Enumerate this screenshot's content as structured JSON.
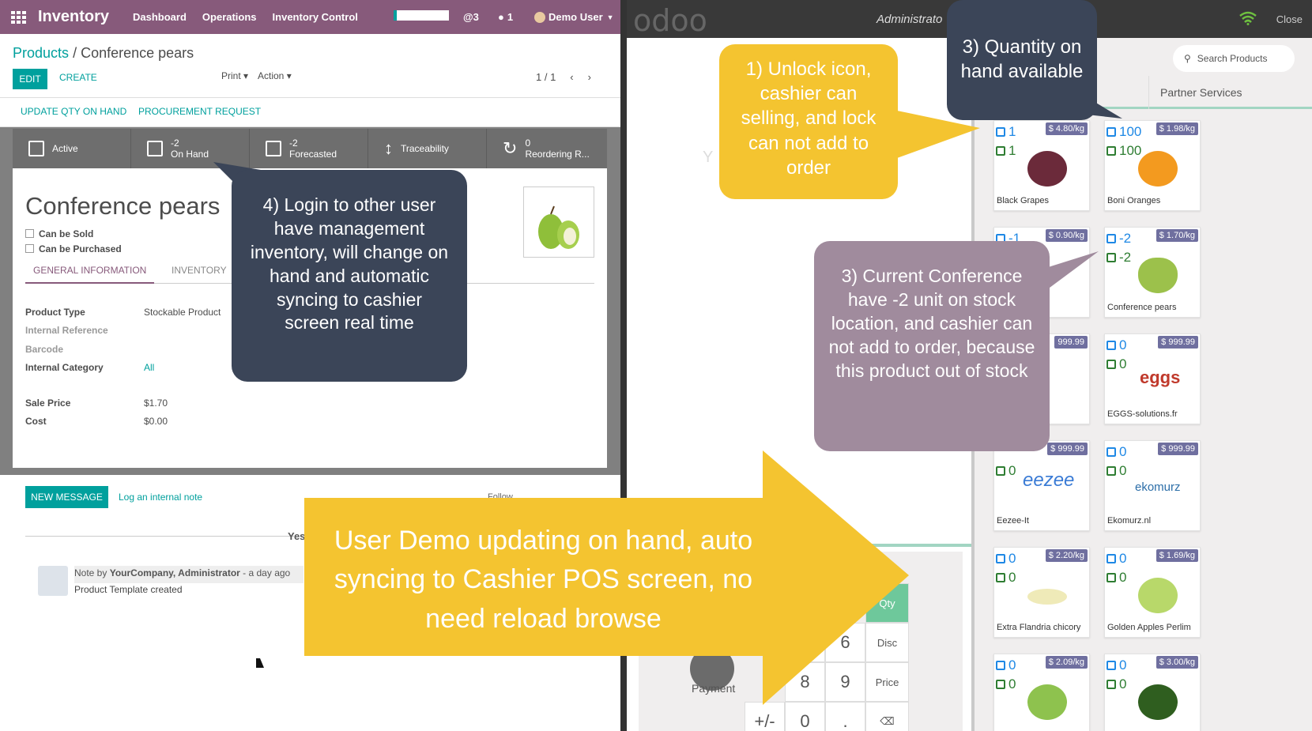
{
  "odoo": {
    "app_name": "Inventory",
    "menus": [
      "Dashboard",
      "Operations",
      "Inventory Control"
    ],
    "activity_count": "@3",
    "message_count": "1",
    "user": "Demo User",
    "breadcrumb": {
      "parent": "Products",
      "sep": "/",
      "current": "Conference pears"
    },
    "edit": "EDIT",
    "create": "CREATE",
    "print": "Print",
    "action": "Action",
    "pager": "1 / 1",
    "header_buttons": [
      "UPDATE QTY ON HAND",
      "PROCUREMENT REQUEST"
    ],
    "stat_buttons": [
      {
        "value": "",
        "label": "Active"
      },
      {
        "value": "-2",
        "label": "On Hand"
      },
      {
        "value": "-2",
        "label": "Forecasted"
      },
      {
        "value": "",
        "label": "Traceability"
      },
      {
        "value": "0",
        "label": "Reordering R..."
      }
    ],
    "product_name": "Conference pears",
    "can_be_sold": "Can be Sold",
    "can_be_purchased": "Can be Purchased",
    "tabs": [
      "GENERAL INFORMATION",
      "INVENTORY"
    ],
    "fields": {
      "product_type_label": "Product Type",
      "product_type": "Stockable Product",
      "internal_ref_label": "Internal Reference",
      "barcode_label": "Barcode",
      "category_label": "Internal Category",
      "category": "All",
      "sale_price_label": "Sale Price",
      "sale_price": "$1.70",
      "cost_label": "Cost",
      "cost": "$0.00"
    },
    "chatter": {
      "new_message": "NEW MESSAGE",
      "log_note": "Log an internal note",
      "follow": "Follow",
      "yesterday": "Yes",
      "note_prefix": "Note by",
      "note_author": "YourCompany, Administrator",
      "note_time": "- a day ago",
      "note_body": "Product Template created"
    }
  },
  "pos": {
    "logo": "odoo",
    "admin": "Administrato",
    "close": "Close",
    "search_placeholder": "Search Products",
    "category": "Partner Services",
    "ghost_text": "Y",
    "products": [
      {
        "name": "Black Grapes",
        "price": "$ 4.80/kg",
        "q1": "1",
        "q2": "1"
      },
      {
        "name": "Boni Oranges",
        "price": "$ 1.98/kg",
        "q1": "100",
        "q2": "100"
      },
      {
        "name": "",
        "price": "$ 0.90/kg",
        "q1": "-1",
        "q2": ""
      },
      {
        "name": "Conference pears",
        "price": "$ 1.70/kg",
        "q1": "-2",
        "q2": "-2"
      },
      {
        "name": "",
        "price": "999.99",
        "q1": "",
        "q2": ""
      },
      {
        "name": "EGGS-solutions.fr",
        "price": "$ 999.99",
        "q1": "0",
        "q2": "0"
      },
      {
        "name": "Eezee-It",
        "price": "$ 999.99",
        "q1": "",
        "q2": "0"
      },
      {
        "name": "Ekomurz.nl",
        "price": "$ 999.99",
        "q1": "0",
        "q2": "0"
      },
      {
        "name": "Extra Flandria chicory",
        "price": "$ 2.20/kg",
        "q1": "0",
        "q2": "0"
      },
      {
        "name": "Golden Apples Perlim",
        "price": "$ 1.69/kg",
        "q1": "0",
        "q2": "0"
      },
      {
        "name": "",
        "price": "$ 2.09/kg",
        "q1": "0",
        "q2": "0"
      },
      {
        "name": "",
        "price": "$ 3.00/kg",
        "q1": "0",
        "q2": "0"
      }
    ],
    "logo_eggs": "eggs",
    "logo_eezee": "eezee",
    "logo_ekomurz": "ekomurz",
    "numpad": {
      "qty": "Qty",
      "disc": "Disc",
      "price": "Price",
      "payment": "Payment",
      "k6": "6",
      "k8": "8",
      "k9": "9",
      "pm": "+/-",
      "k0": "0",
      "dot": ".",
      "bk": "⌫"
    }
  },
  "callouts": {
    "c1": "1) Unlock icon, cashier can selling, and lock can not add to order",
    "c3a": "3) Quantity on hand available",
    "c3b": "3) Current Conference have -2 unit on stock location, and cashier can not add to order, because this product out of stock",
    "c4": "4) Login to other user have management inventory, will change on hand and automatic syncing to cashier screen real time",
    "arrow": "User Demo updating on hand, auto syncing to Cashier POS screen, no need reload browse"
  },
  "colors": {
    "odoo_purple": "#875a7b",
    "teal": "#00a09d",
    "callout_yellow": "#f4c430",
    "callout_dark": "#3b4558",
    "callout_mauve": "#a08b9d"
  }
}
